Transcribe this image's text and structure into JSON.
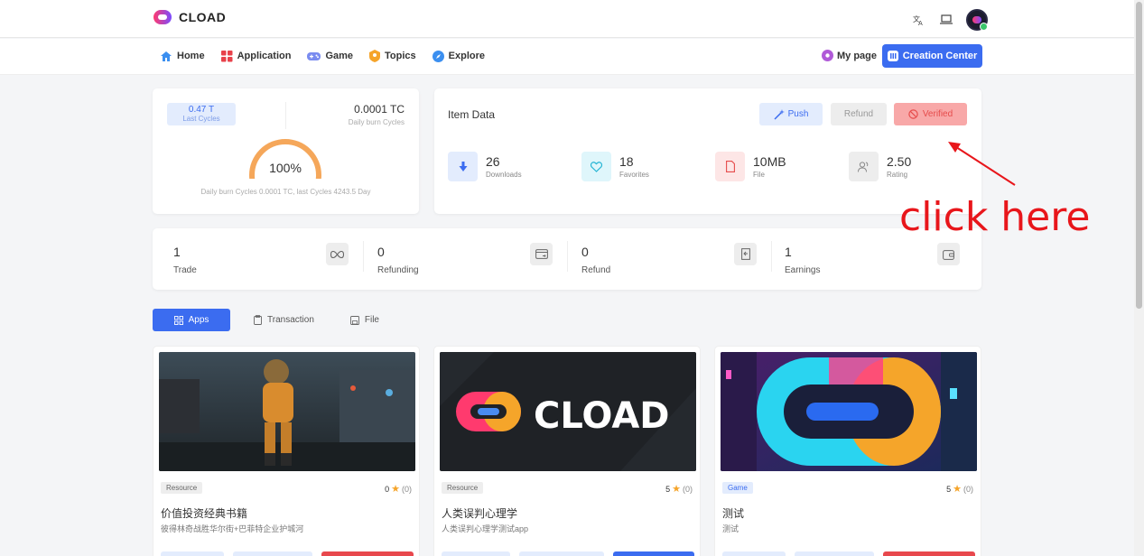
{
  "app": {
    "name": "CLOAD"
  },
  "nav": {
    "items": [
      {
        "label": "Home",
        "icon": "home-icon",
        "color": "#3b8ff0"
      },
      {
        "label": "Application",
        "icon": "apps-icon",
        "color": "#e8414a"
      },
      {
        "label": "Game",
        "icon": "gamepad-icon",
        "color": "#7a8cf0"
      },
      {
        "label": "Topics",
        "icon": "topics-icon",
        "color": "#f5a42a"
      },
      {
        "label": "Explore",
        "icon": "compass-icon",
        "color": "#3b8ff0"
      }
    ],
    "my_page": "My page",
    "creation_center": "Creation Center"
  },
  "cycles": {
    "last_value": "0.47 T",
    "last_label": "Last Cycles",
    "daily_value": "0.0001 TC",
    "daily_label": "Daily burn Cycles",
    "gauge_percent": 100,
    "gauge_text": "100%",
    "footer": "Daily burn Cycles 0.0001 TC, last Cycles 4243.5 Day"
  },
  "item_data": {
    "title": "Item Data",
    "push": "Push",
    "refund": "Refund",
    "verified": "Verified",
    "stats": [
      {
        "value": "26",
        "label": "Downloads",
        "icon": "download-icon"
      },
      {
        "value": "18",
        "label": "Favorites",
        "icon": "heart-icon"
      },
      {
        "value": "10MB",
        "label": "File",
        "icon": "file-icon"
      },
      {
        "value": "2.50",
        "label": "Rating",
        "icon": "users-icon"
      }
    ]
  },
  "metrics": [
    {
      "value": "1",
      "label": "Trade",
      "icon": "infinity-icon"
    },
    {
      "value": "0",
      "label": "Refunding",
      "icon": "card-refund-icon"
    },
    {
      "value": "0",
      "label": "Refund",
      "icon": "receipt-icon"
    },
    {
      "value": "1",
      "label": "Earnings",
      "icon": "wallet-icon"
    }
  ],
  "tabs": [
    {
      "label": "Apps",
      "icon": "grid-icon"
    },
    {
      "label": "Transaction",
      "icon": "clipboard-icon"
    },
    {
      "label": "File",
      "icon": "save-icon"
    }
  ],
  "products": [
    {
      "badge": "Resource",
      "rating": "0",
      "count": "(0)",
      "title": "价值投资经典书籍",
      "desc": "彼得林奇战胜华尔街+巴菲特企业护城河"
    },
    {
      "badge": "Resource",
      "rating": "5",
      "count": "(0)",
      "title": "人类误判心理学",
      "desc": "人类误判心理学测试app"
    },
    {
      "badge": "Game",
      "rating": "5",
      "count": "(0)",
      "title": "测试",
      "desc": "测试"
    }
  ],
  "annotation": {
    "text": "click here",
    "color": "#e8161b"
  }
}
